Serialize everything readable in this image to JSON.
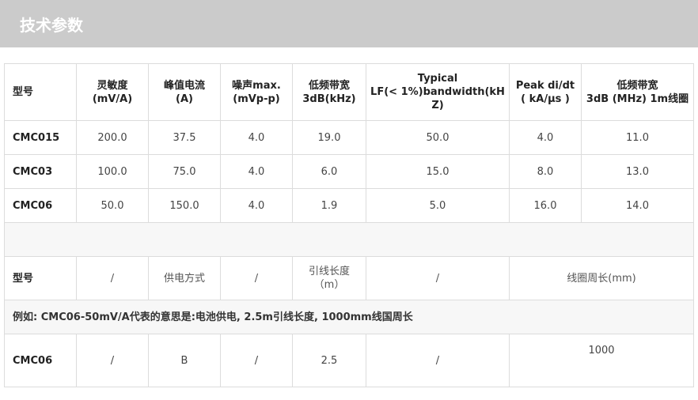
{
  "page": {
    "title": "技术参数"
  },
  "table": {
    "header": [
      "型号",
      "灵敏度\n(mV/A)",
      "峰值电流\n(A)",
      "噪声max.\n(mVp-p)",
      "低频带宽\n3dB(kHz)",
      "Typical\nLF(< 1%)bandwidth(kHZ)",
      "Peak di/dt\n( kA/μs )",
      "低频带宽\n3dB (MHz) 1m线圈"
    ],
    "rows": [
      [
        "CMC015",
        "200.0",
        "37.5",
        "4.0",
        "19.0",
        "50.0",
        "4.0",
        "11.0"
      ],
      [
        "CMC03",
        "100.0",
        "75.0",
        "4.0",
        "6.0",
        "15.0",
        "8.0",
        "13.0"
      ],
      [
        "CMC06",
        "50.0",
        "150.0",
        "4.0",
        "1.9",
        "5.0",
        "16.0",
        "14.0"
      ]
    ],
    "order_header": [
      "型号",
      "/",
      "供电方式",
      "/",
      "引线长度\n（m）",
      "/",
      "线圈周长(mm)"
    ],
    "example_note": "例如: CMC06-50mV/A代表的意思是:电池供电, 2.5m引线长度, 1000mm线国周长",
    "example_row": [
      "CMC06",
      "/",
      "B",
      "/",
      "2.5",
      "/",
      "1000"
    ]
  }
}
